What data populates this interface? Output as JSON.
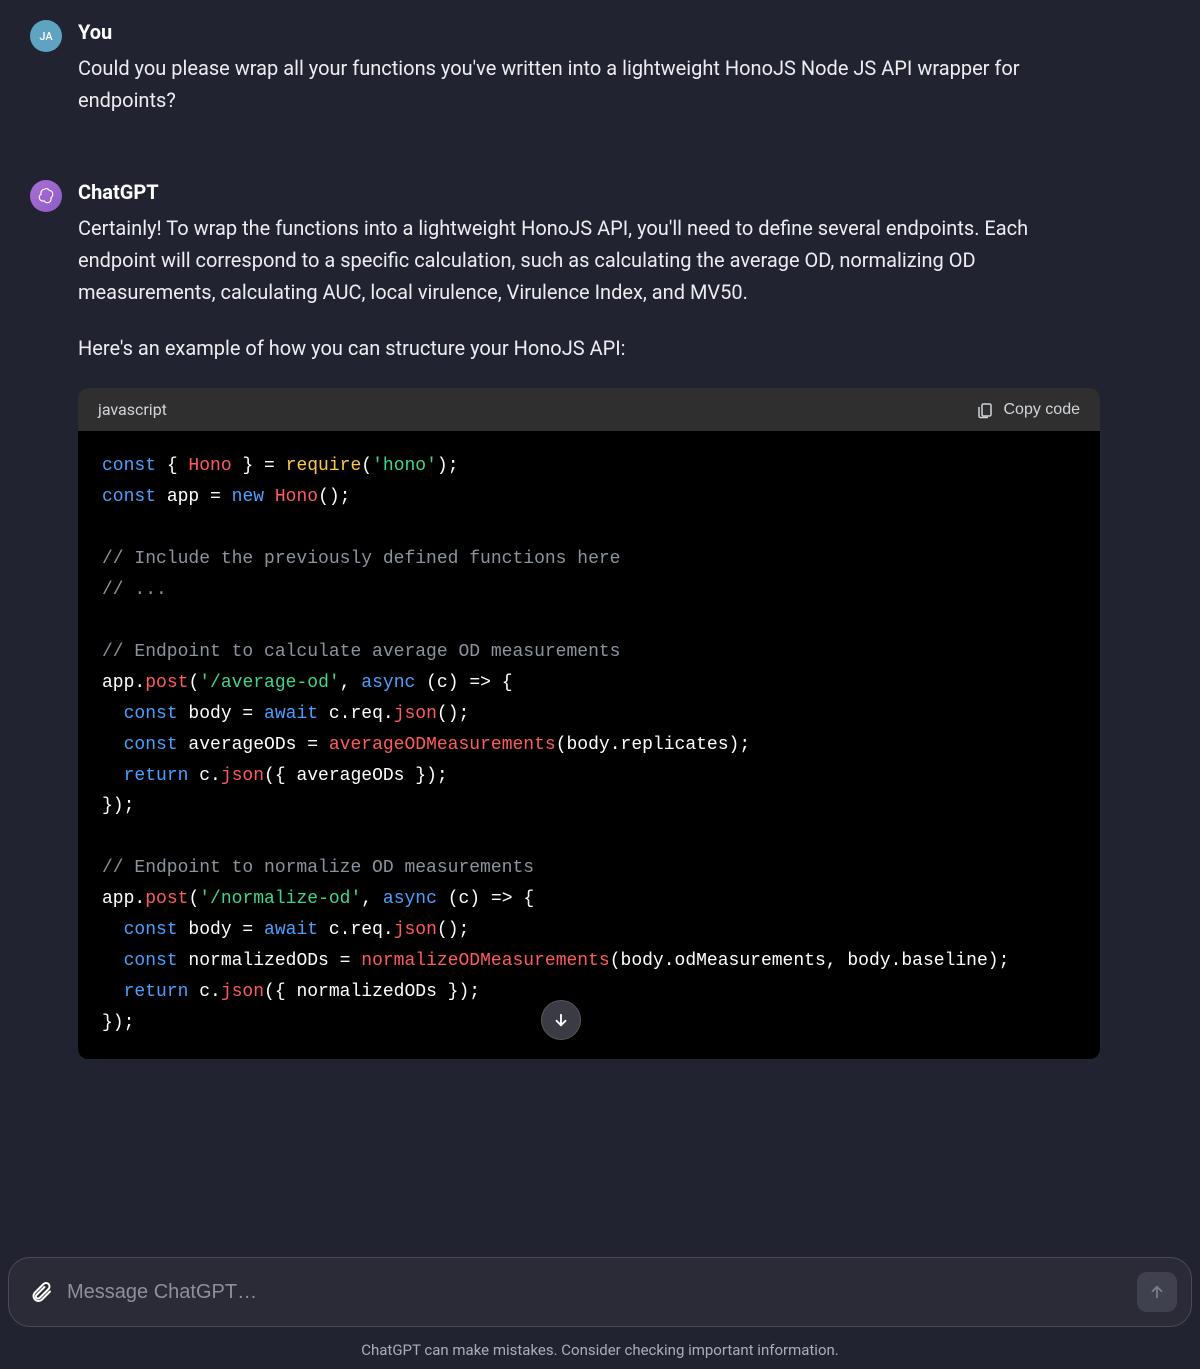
{
  "user": {
    "name": "You",
    "initials": "JA",
    "message": "Could you please wrap all your functions you've written into a lightweight HonoJS Node JS API wrapper for endpoints?"
  },
  "assistant": {
    "name": "ChatGPT",
    "para1": "Certainly! To wrap the functions into a lightweight HonoJS API, you'll need to define several endpoints. Each endpoint will correspond to a specific calculation, such as calculating the average OD, normalizing OD measurements, calculating AUC, local virulence, Virulence Index, and MV50.",
    "para2": "Here's an example of how you can structure your HonoJS API:"
  },
  "code": {
    "language": "javascript",
    "copy_label": "Copy code",
    "tokens": {
      "const": "const",
      "new": "new",
      "hono": "Hono",
      "require": "require",
      "hono_str": "'hono'",
      "app": "app",
      "comment1": "// Include the previously defined functions here",
      "comment2": "// ...",
      "comment3": "// Endpoint to calculate average OD measurements",
      "comment4": "// Endpoint to normalize OD measurements",
      "post": "post",
      "route1": "'/average-od'",
      "route2": "'/normalize-od'",
      "async": "async",
      "await": "await",
      "json": "json",
      "return": "return",
      "fn1": "averageODMeasurements",
      "fn2": "normalizeODMeasurements",
      "body": "body",
      "averageODs": "averageODs",
      "normalizedODs": "normalizedODs",
      "c": "c",
      "req": "req",
      "replicates": "replicates",
      "odMeasurements": "odMeasurements",
      "baseline": "baseline"
    }
  },
  "input": {
    "placeholder": "Message ChatGPT…"
  },
  "disclaimer": "ChatGPT can make mistakes. Consider checking important information."
}
